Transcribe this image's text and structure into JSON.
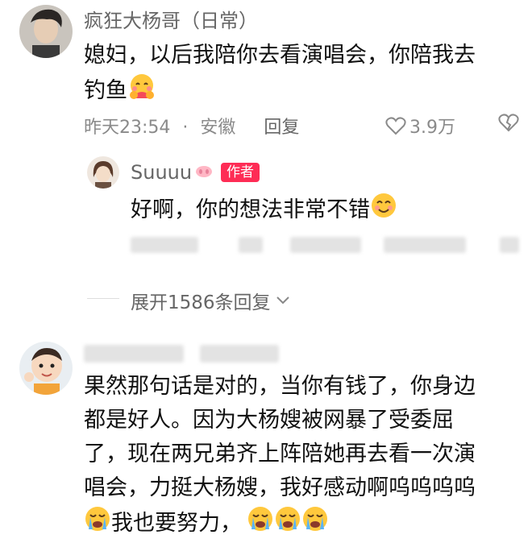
{
  "comment1": {
    "username": "疯狂大杨哥（日常）",
    "lines": [
      "媳妇，以后我陪你去看演唱会，你陪我去",
      "钓鱼"
    ],
    "time": "昨天23:54",
    "separator": "·",
    "location": "安徽",
    "reply_label": "回复",
    "likes": "3.9万",
    "emoji": "hugging-face-emoji"
  },
  "reply1": {
    "username": "Suuuu",
    "author_badge": "作者",
    "text": "好啊，你的想法非常不错",
    "emoji": "smiling-face-emoji"
  },
  "expand": {
    "label": "展开1586条回复"
  },
  "comment2": {
    "lines": [
      "果然那句话是对的，当你有钱了，你身边",
      "都是好人。因为大杨嫂被网暴了受委屈",
      "了，现在两兄弟齐上阵陪她再去看一次演",
      "唱会，力挺大杨嫂，我好感动啊呜呜呜呜"
    ],
    "last_line_text": "我也要努力，",
    "emoji": "loudly-crying-face-emoji"
  },
  "colors": {
    "badge": "#fe2c55",
    "meta": "#8a8a8a",
    "name": "#666666"
  }
}
